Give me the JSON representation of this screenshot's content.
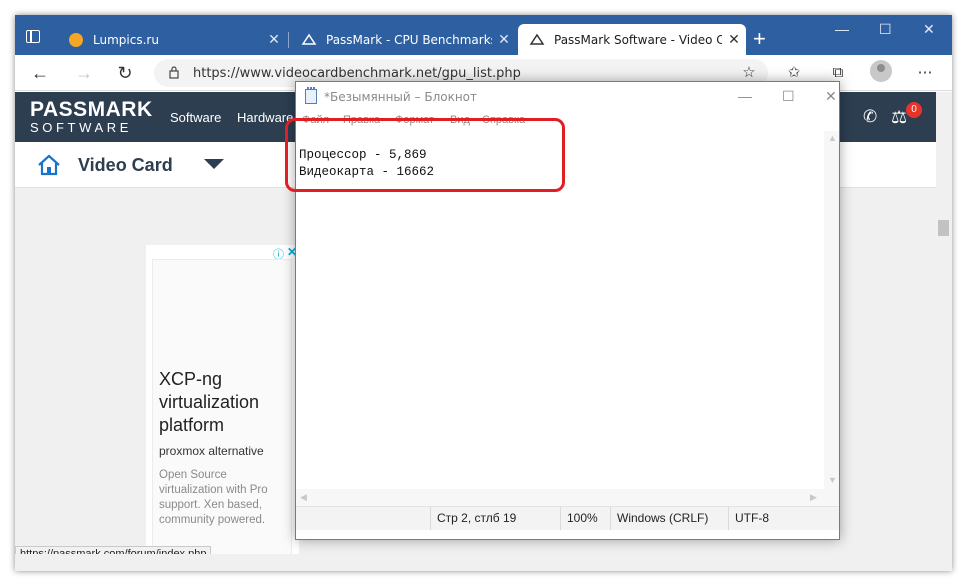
{
  "browser": {
    "tabs": [
      {
        "label": "Lumpics.ru",
        "icon": "lumpics-favicon"
      },
      {
        "label": "PassMark - CPU Benchmarks - L",
        "icon": "passmark-favicon"
      },
      {
        "label": "PassMark Software - Video Card",
        "icon": "passmark-favicon"
      }
    ],
    "new_tab": "+",
    "url": "https://www.videocardbenchmark.net/gpu_list.php",
    "window_controls": [
      "—",
      "☐",
      "✕"
    ]
  },
  "page": {
    "logo_top": "PASSMARK",
    "logo_bottom": "SOFTWARE",
    "menu": [
      "Software",
      "Hardware"
    ],
    "cart_count": "0",
    "section_title": "Video Card",
    "ad": {
      "headline": "XCP-ng virtualization platform",
      "subtitle": "proxmox alternative",
      "body": "Open Source virtualization with Pro support. Xen based, community powered."
    },
    "status_url": "https://passmark.com/forum/index.php"
  },
  "notepad": {
    "title": "*Безымянный – Блокнот",
    "menu": [
      "Файл",
      "Правка",
      "Формат",
      "Вид",
      "Справка"
    ],
    "lines": [
      "Процессор - 5,869",
      "Видеокарта - 16662"
    ],
    "status": {
      "position": "Стр 2, стлб 19",
      "zoom": "100%",
      "line_endings": "Windows (CRLF)",
      "encoding": "UTF-8"
    },
    "controls": [
      "—",
      "☐",
      "✕"
    ]
  },
  "colors": {
    "browser_accent": "#2e5fa0",
    "passmark_nav": "#2d3e50",
    "highlight": "#e01e24"
  }
}
